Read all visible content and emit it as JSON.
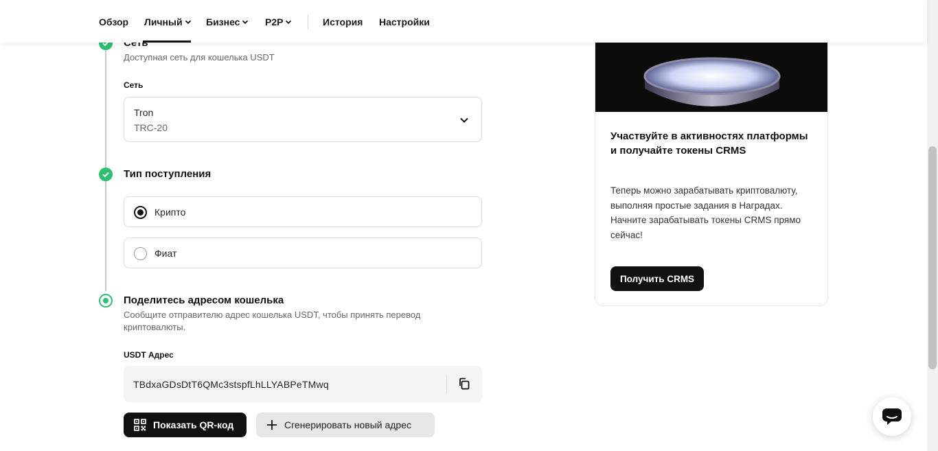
{
  "nav": {
    "items": [
      {
        "label": "Обзор",
        "dropdown": false
      },
      {
        "label": "Личный",
        "dropdown": true
      },
      {
        "label": "Бизнес",
        "dropdown": true
      },
      {
        "label": "P2P",
        "dropdown": true
      },
      {
        "label": "История",
        "dropdown": false
      },
      {
        "label": "Настройки",
        "dropdown": false
      }
    ],
    "active": "Личный"
  },
  "network_step": {
    "title": "Сеть",
    "description": "Доступная сеть для кошелька USDT",
    "field_label": "Сеть",
    "selected_name": "Tron",
    "selected_standard": "TRC-20"
  },
  "deposit_type_step": {
    "title": "Тип поступления",
    "options": [
      {
        "label": "Крипто",
        "checked": true
      },
      {
        "label": "Фиат",
        "checked": false
      }
    ]
  },
  "share_step": {
    "title": "Поделитесь адресом кошелька",
    "description": "Сообщите отправителю адрес кошелька USDT, чтобы принять перевод криптовалюты.",
    "address_label": "USDT Адрес",
    "address": "TBdxaGDsDtT6QMc3stspfLhLLYABPeTMwq",
    "qr_button": "Показать QR-код",
    "generate_button": "Сгенерировать новый адрес"
  },
  "promo": {
    "title": "Участвуйте в активностях платформы и получайте токены CRMS",
    "text": "Теперь можно зарабатывать криптовалюту, выполняя простые задания в Наградах. Начните зарабатывать токены CRMS прямо сейчас!",
    "button": "Получить CRMS"
  },
  "colors": {
    "accent_green": "#2fbf71",
    "primary_dark": "#111111"
  }
}
